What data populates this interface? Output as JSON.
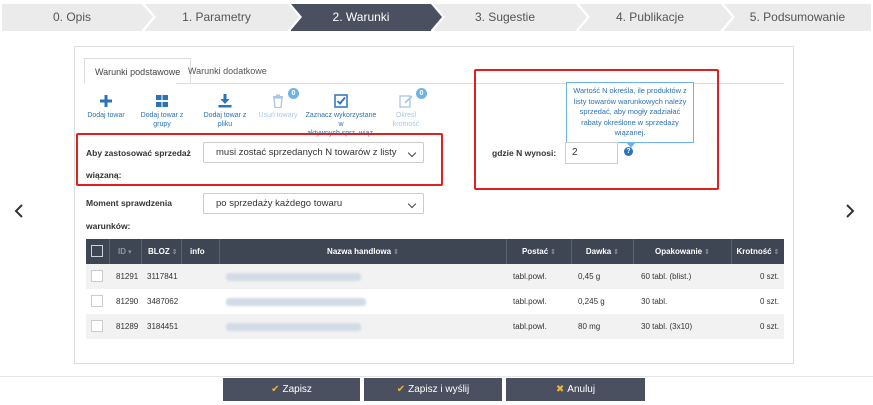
{
  "steps": [
    "0. Opis",
    "1. Parametry",
    "2. Warunki",
    "3. Sugestie",
    "4. Publikacje",
    "5. Podsumowanie"
  ],
  "active_step_index": 2,
  "tabs": [
    "Warunki podstawowe",
    "Warunki dodatkowe"
  ],
  "toolbar": {
    "add": "Dodaj towar",
    "add_group": "Dodaj towar z grupy",
    "add_file": "Dodaj towar z pliku",
    "remove": "Usuń towary",
    "remove_badge": "0",
    "mark_used_line1": "Zaznacz wykorzystane w",
    "mark_used_line2": "aktywnych sprz. wiąz.",
    "edit_qty": "Określ krotność",
    "edit_badge": "0"
  },
  "form": {
    "apply_label_line1": "Aby zastosować sprzedaż",
    "apply_label_line2": "wiązaną:",
    "apply_value": "musi zostać sprzedanych N towarów z listy",
    "moment_label_line1": "Moment sprawdzenia",
    "moment_label_line2": "warunków:",
    "moment_value": "po sprzedaży każdego towaru",
    "n_label": "gdzie N wynosi:",
    "n_value": "2",
    "help_mark": "?",
    "tooltip": "Wartość N określa, ile produktów z listy towarów warunkowych należy sprzedać, aby mogły zadziałać rabaty określone w sprzedaży wiązanej."
  },
  "table": {
    "headers": {
      "id": "ID",
      "bloz": "BLOZ",
      "info": "info",
      "name": "Nazwa handlowa",
      "form": "Postać",
      "dose": "Dawka",
      "pack": "Opakowanie",
      "mult": "Krotność"
    },
    "rows": [
      {
        "id": "81291",
        "bloz": "3117841",
        "form": "tabl.powl.",
        "dose": "0,45 g",
        "pack": "60 tabl. (blist.)",
        "mult": "0 szt."
      },
      {
        "id": "81290",
        "bloz": "3487062",
        "form": "tabl.powl.",
        "dose": "0,245 g",
        "pack": "30 tabl.",
        "mult": "0 szt."
      },
      {
        "id": "81289",
        "bloz": "3184451",
        "form": "tabl.powl.",
        "dose": "80 mg",
        "pack": "30 tabl. (3x10)",
        "mult": "0 szt."
      }
    ]
  },
  "buttons": {
    "save": "Zapisz",
    "save_send": "Zapisz i wyślij",
    "cancel": "Anuluj"
  },
  "colors": {
    "accent": "#2a73b8",
    "dark": "#4a5060",
    "highlight": "#e0201e",
    "check": "#f2b233"
  }
}
